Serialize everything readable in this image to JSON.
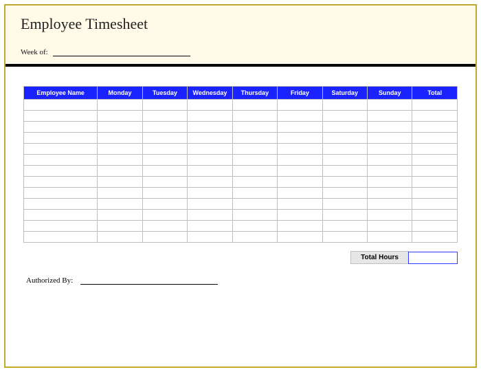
{
  "title": "Employee Timesheet",
  "week_of_label": "Week of:",
  "columns": [
    "Employee Name",
    "Monday",
    "Tuesday",
    "Wednesday",
    "Thursday",
    "Friday",
    "Saturday",
    "Sunday",
    "Total"
  ],
  "row_count": 13,
  "total_hours_label": "Total Hours",
  "total_hours_value": "",
  "authorized_by_label": "Authorized By:"
}
